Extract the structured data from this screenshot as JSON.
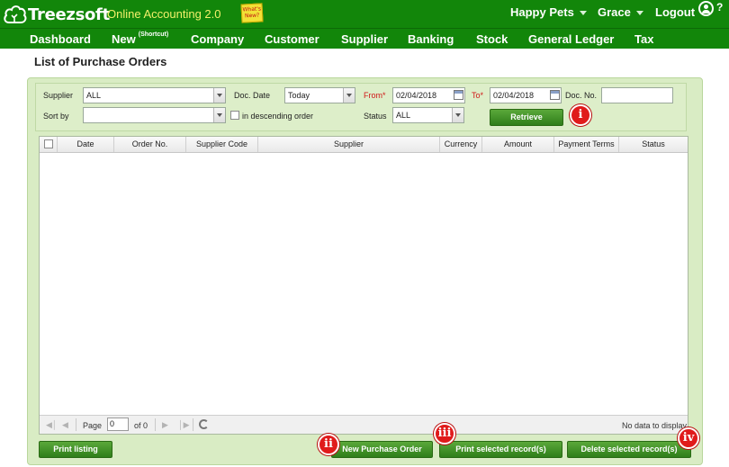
{
  "header": {
    "brand": "Treezsoft",
    "product": "Online Accounting 2.0",
    "whats_new": "What's New?",
    "company": "Happy Pets",
    "user": "Grace",
    "logout": "Logout",
    "help": "?"
  },
  "nav": {
    "items": [
      "Dashboard",
      "New",
      "Company",
      "Customer",
      "Supplier",
      "Banking",
      "Stock",
      "General Ledger",
      "Tax"
    ],
    "new_sup": "(Shortcut)"
  },
  "page": {
    "title": "List of Purchase Orders"
  },
  "filters": {
    "supplier_label": "Supplier",
    "supplier_value": "ALL",
    "docdate_label": "Doc. Date",
    "docdate_value": "Today",
    "from_label": "From",
    "from_value": "02/04/2018",
    "to_label": "To",
    "to_value": "02/04/2018",
    "docno_label": "Doc. No.",
    "docno_value": "",
    "sortby_label": "Sort by",
    "sortby_value": "",
    "descending_label": "in descending order",
    "status_label": "Status",
    "status_value": "ALL",
    "required_mark": "*",
    "retrieve_label": "Retrieve"
  },
  "grid": {
    "columns": [
      "Date",
      "Order No.",
      "Supplier Code",
      "Supplier",
      "Currency",
      "Amount",
      "Payment Terms",
      "Status"
    ],
    "rows": [],
    "page_label": "Page",
    "page_value": "0",
    "of_label": "of 0",
    "empty_text": "No data to display"
  },
  "actions": {
    "print_listing": "Print listing",
    "new_po": "New Purchase Order",
    "print_selected": "Print selected record(s)",
    "delete_selected": "Delete selected record(s)"
  },
  "badges": [
    "i",
    "ii",
    "iii",
    "iv"
  ],
  "colors": {
    "header_green": "#12860a",
    "product_yellow": "#f3f06a",
    "panel_green": "#d9ecc4",
    "button_green": "#2f7e1a",
    "badge_red": "#e01b1b",
    "required_red": "#d01818"
  }
}
